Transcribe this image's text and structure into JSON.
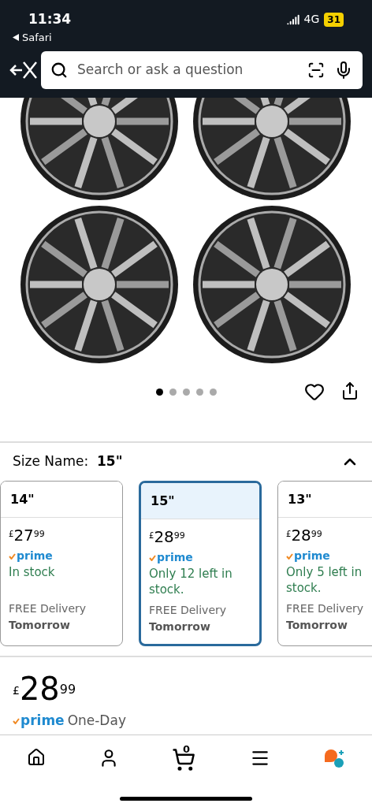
{
  "status_bar": {
    "time": "11:34",
    "back_app": "Safari",
    "network": "4G",
    "battery": "31"
  },
  "search": {
    "placeholder": "Search or ask a question"
  },
  "carousel": {
    "dots": [
      {
        "selected": true
      },
      {
        "selected": false
      },
      {
        "selected": false
      },
      {
        "selected": false
      },
      {
        "selected": false
      }
    ]
  },
  "size": {
    "label": "Size Name:",
    "value": "15\"",
    "expanded": true
  },
  "size_options": [
    {
      "name": "14\"",
      "currency": "£",
      "price": "27",
      "pence": "99",
      "badge": "prime",
      "stock": "In stock",
      "delivery": "FREE Delivery",
      "day": "Tomorrow",
      "selected": false
    },
    {
      "name": "15\"",
      "currency": "£",
      "price": "28",
      "pence": "99",
      "badge": "prime",
      "stock": "Only 12 left in stock.",
      "delivery": "FREE Delivery",
      "day": "Tomorrow",
      "selected": true
    },
    {
      "name": "13\"",
      "currency": "£",
      "price": "28",
      "pence": "99",
      "badge": "prime",
      "stock": "Only 5 left in stock.",
      "delivery": "FREE Delivery",
      "day": "Tomorrow",
      "selected": false
    }
  ],
  "price": {
    "currency": "£",
    "amount": "28",
    "pence": "99",
    "badge": "prime",
    "delivery": "One-Day"
  },
  "nav": {
    "cart_count": "0"
  }
}
